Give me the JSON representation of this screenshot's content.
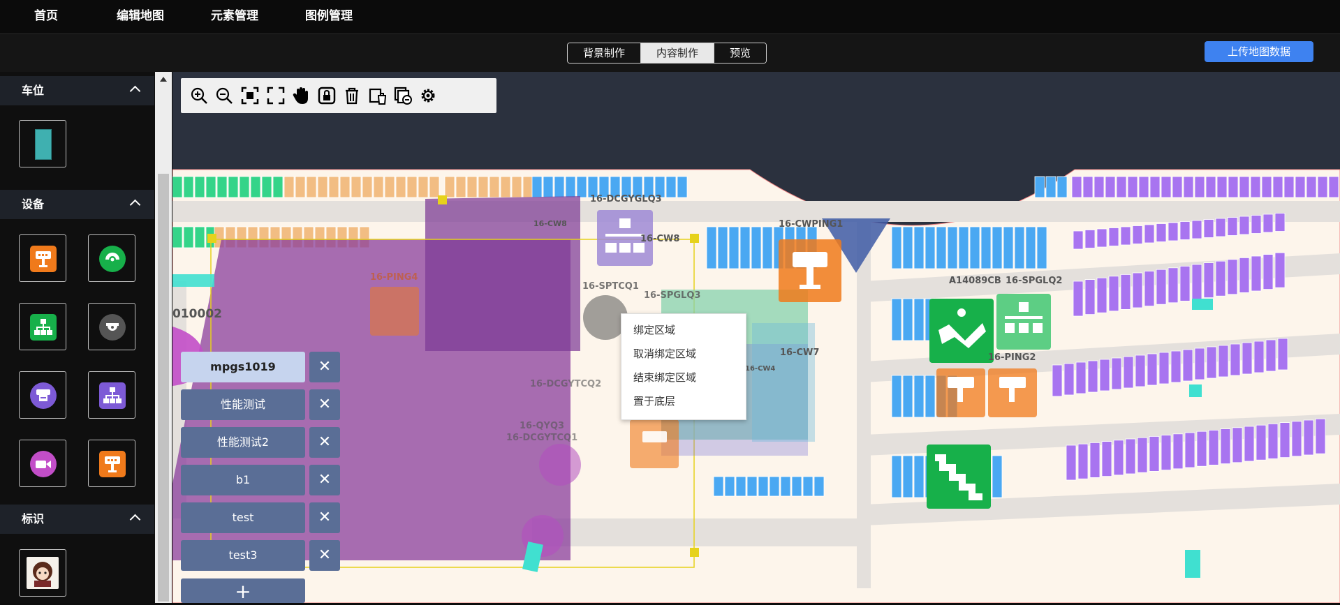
{
  "nav": {
    "items": [
      {
        "label": "首页"
      },
      {
        "label": "编辑地图"
      },
      {
        "label": "元素管理"
      },
      {
        "label": "图例管理"
      }
    ]
  },
  "modes": {
    "tabs": [
      {
        "label": "背景制作"
      },
      {
        "label": "内容制作"
      },
      {
        "label": "预览"
      }
    ],
    "active": "内容制作"
  },
  "upload_label": "上传地图数据",
  "sidebar": {
    "sections": [
      {
        "title": "车位"
      },
      {
        "title": "设备"
      },
      {
        "title": "标识"
      }
    ]
  },
  "context_menu": {
    "items": [
      {
        "label": "绑定区域"
      },
      {
        "label": "取消绑定区域"
      },
      {
        "label": "结束绑定区域"
      },
      {
        "label": "置于底层"
      }
    ]
  },
  "layers": {
    "items": [
      {
        "label": "mpgs1019",
        "selected": true
      },
      {
        "label": "性能测试"
      },
      {
        "label": "性能测试2"
      },
      {
        "label": "b1"
      },
      {
        "label": "test"
      },
      {
        "label": "test3"
      }
    ],
    "add_label": "+",
    "delete_glyph": "✕"
  },
  "map": {
    "labels": {
      "dcgyglq3": "16-DCGYGLQ3",
      "cwping1": "16-CWPING1",
      "cw8": "16-CW8",
      "cw8b": "16-CW8",
      "ping4": "16-PING4",
      "sptcq1": "16-SPTCQ1",
      "spglq3": "16-SPGLQ3",
      "cw7": "16-CW7",
      "cw4": "16-CW4",
      "dcgytcq2": "16-DCGYTCQ2",
      "qyq3": "16-QYQ3",
      "dcgytcq1": "16-DCGYTCQ1",
      "a14089cb": "A14089CB",
      "spglq2": "16-SPGLQ2",
      "ping2": "16-PING2",
      "code_010002": "010002"
    }
  },
  "colors": {
    "accent": "#3e82f0",
    "parking_blue": "#4aa8f2",
    "parking_purple": "#a874f0",
    "parking_orange": "#f2bd83",
    "parking_green": "#34d489",
    "selection_purple": "#8a3e9c",
    "device_green": "#17b04a",
    "device_orange": "#f07a1b"
  }
}
